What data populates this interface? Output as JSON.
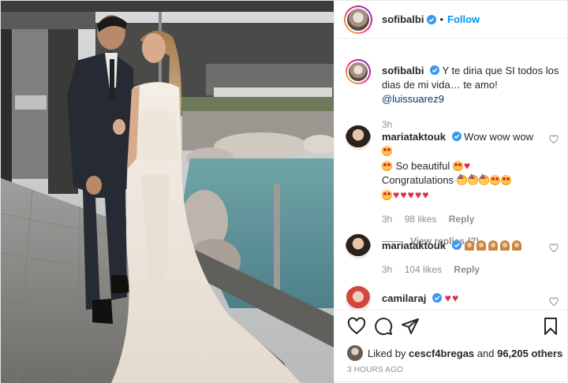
{
  "post": {
    "author": "sofibalbi",
    "follow_label": "Follow",
    "separator": "•"
  },
  "caption": {
    "username": "sofibalbi",
    "text": "Y te diria que SI todos los dias de mi vida… te amo!",
    "mention": "@luissuarez9",
    "time": "3h"
  },
  "comments": [
    {
      "username": "mariataktouk",
      "line1": "Wow wow wow",
      "line2": "So beautiful",
      "line3": "Congratulations",
      "time": "3h",
      "likes": "98 likes",
      "reply_label": "Reply",
      "view_replies": "View replies (2)"
    },
    {
      "username": "mariataktouk",
      "time": "3h",
      "likes": "104 likes",
      "reply_label": "Reply"
    },
    {
      "username": "camilaraj"
    }
  ],
  "footer": {
    "liked_by_prefix": "Liked by ",
    "liked_by_user": "cescf4bregas",
    "liked_by_mid": " and ",
    "liked_by_count": "96,205 others",
    "timestamp": "3 HOURS AGO"
  },
  "icons": {
    "verified": "verified-badge-icon",
    "like": "heart-outline-icon",
    "comment": "comment-bubble-icon",
    "share": "paper-plane-icon",
    "save": "bookmark-icon"
  },
  "colors": {
    "accent": "#0095f6",
    "verified": "#3897f0",
    "muted": "#8e8e8e",
    "text": "#262626"
  }
}
